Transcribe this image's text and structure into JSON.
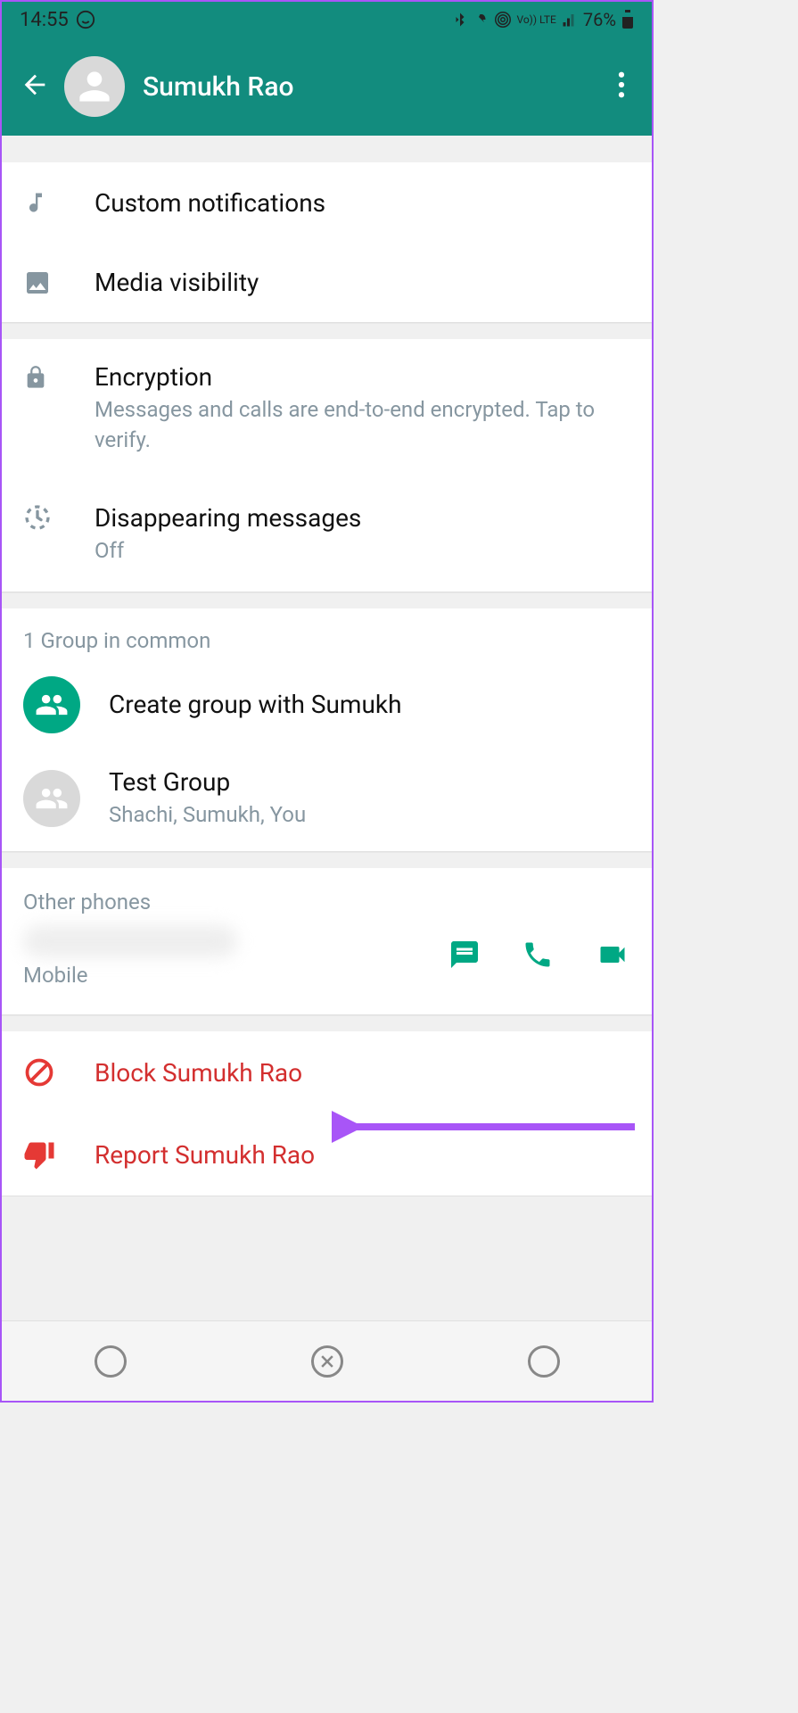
{
  "status_bar": {
    "time": "14:55",
    "battery": "76%",
    "indicators": "Vo)) LTE"
  },
  "header": {
    "contact_name": "Sumukh Rao"
  },
  "settings": {
    "custom_notifications": "Custom notifications",
    "media_visibility": "Media visibility",
    "encryption_title": "Encryption",
    "encryption_subtitle": "Messages and calls are end-to-end encrypted. Tap to verify.",
    "disappearing_title": "Disappearing messages",
    "disappearing_value": "Off"
  },
  "groups": {
    "header": "1 Group in common",
    "create_label": "Create group with Sumukh",
    "items": [
      {
        "name": "Test Group",
        "members": "Shachi, Sumukh, You"
      }
    ]
  },
  "phones": {
    "header": "Other phones",
    "type": "Mobile"
  },
  "actions": {
    "block": "Block Sumukh Rao",
    "report": "Report Sumukh Rao"
  }
}
